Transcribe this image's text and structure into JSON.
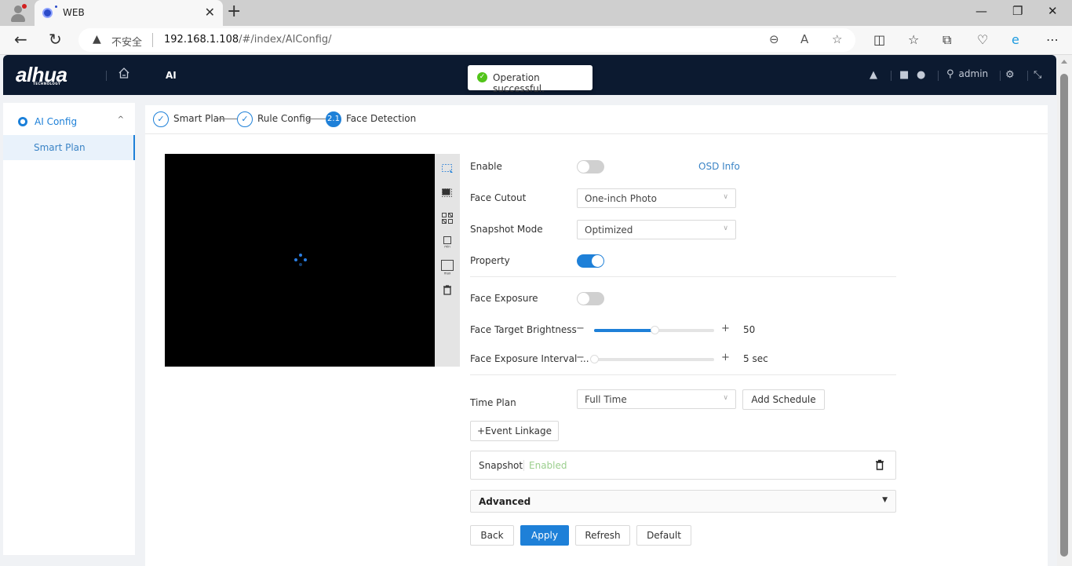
{
  "browser": {
    "tab_title": "WEB",
    "security_label": "不安全",
    "url_host": "192.168.1.108",
    "url_path": "/#/index/AIConfig/",
    "icons": [
      "profile-icon",
      "favicon",
      "close-tab-icon",
      "new-tab-icon",
      "minimize-icon",
      "restore-icon",
      "close-window-icon",
      "back-icon",
      "reload-icon",
      "warning-icon",
      "zoom-out-icon",
      "read-aloud-icon",
      "favorite-star-icon",
      "split-screen-icon",
      "favorites-icon",
      "collections-icon",
      "browser-essentials-icon",
      "ie-mode-icon",
      "more-icon"
    ]
  },
  "header": {
    "logo_text": "alhua",
    "logo_sub": "TECHNOLOGY",
    "nav_item": "AI",
    "toast_message": "Operation successful.",
    "username": "admin",
    "icons": [
      "home-icon",
      "bell-icon",
      "shirt-icon",
      "globe-icon",
      "user-icon",
      "settings-icon",
      "fullscreen-icon"
    ]
  },
  "sidebar": {
    "group_label": "AI Config",
    "items": [
      {
        "label": "Smart Plan",
        "active": true
      }
    ]
  },
  "steps": [
    {
      "label": "Smart Plan",
      "marker": "✓",
      "state": "done"
    },
    {
      "label": "Rule Config",
      "marker": "✓",
      "state": "done"
    },
    {
      "label": "Face Detection",
      "marker": "2.1",
      "state": "active"
    }
  ],
  "video_tools": [
    "draw-rule-icon",
    "draw-exclude-icon",
    "grid-icon",
    "min-size-icon",
    "max-size-icon",
    "delete-icon"
  ],
  "form": {
    "enable": {
      "label": "Enable",
      "on": false
    },
    "osd_info": "OSD Info",
    "face_cutout": {
      "label": "Face Cutout",
      "value": "One-inch Photo"
    },
    "snapshot_mode": {
      "label": "Snapshot Mode",
      "value": "Optimized"
    },
    "property": {
      "label": "Property",
      "on": true
    },
    "face_exposure": {
      "label": "Face Exposure",
      "on": false
    },
    "face_target_brightness": {
      "label": "Face Target Brightness",
      "value": 50,
      "min": 0,
      "max": 100,
      "display": "50"
    },
    "face_exposure_interval": {
      "label": "Face Exposure Interval ...",
      "value": 5,
      "min": 1,
      "max": 1800,
      "display": "5 sec"
    },
    "time_plan": {
      "label": "Time Plan",
      "value": "Full Time"
    },
    "add_schedule": "Add Schedule",
    "event_linkage": "+Event Linkage",
    "snapshot": {
      "label": "Snapshot",
      "status": "Enabled"
    },
    "advanced": "Advanced"
  },
  "actions": {
    "back": "Back",
    "apply": "Apply",
    "refresh": "Refresh",
    "default": "Default"
  },
  "colors": {
    "accent": "#1e80d8",
    "header_bg": "#0c1a30",
    "success": "#52c41a",
    "enabled_text": "#9bcf8e"
  }
}
